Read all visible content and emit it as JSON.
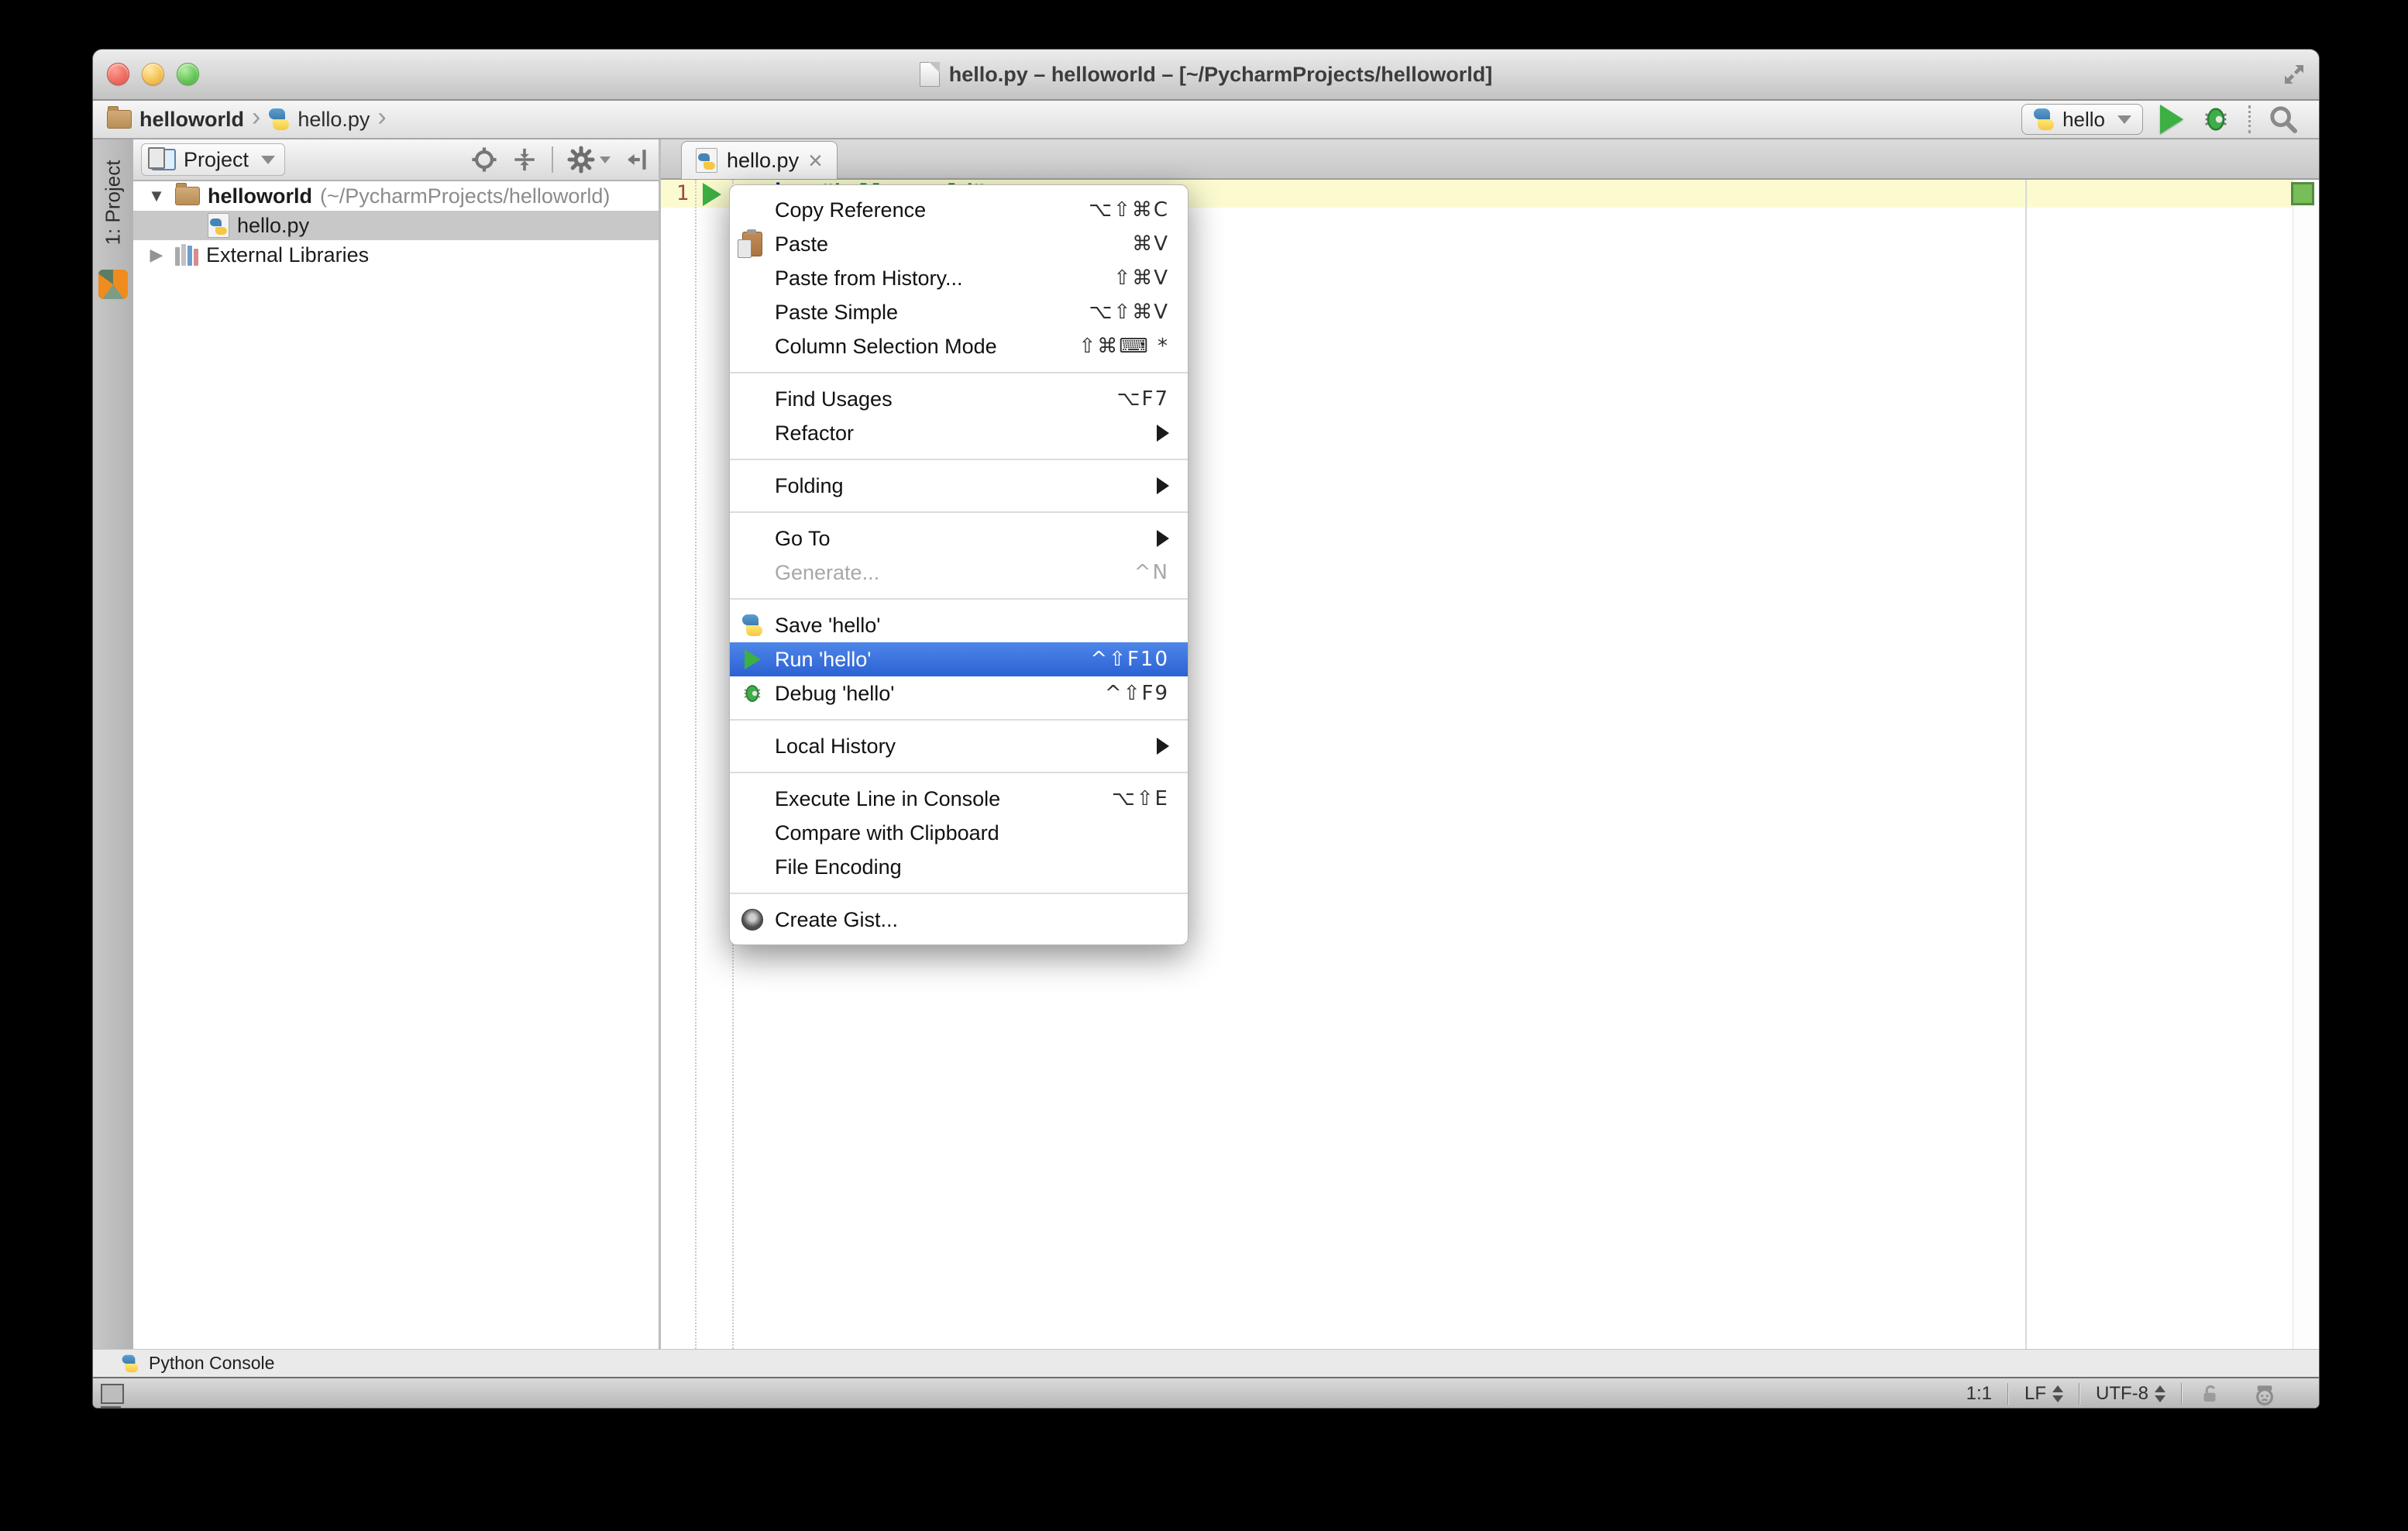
{
  "titlebar": {
    "title": "hello.py – helloworld – [~/PycharmProjects/helloworld]"
  },
  "navbar": {
    "crumb_project": "helloworld",
    "crumb_file": "hello.py",
    "run_config": "hello"
  },
  "left_stripe": {
    "project_button": "1: Project"
  },
  "project_panel": {
    "header_title": "Project",
    "root_label": "helloworld",
    "root_path": "(~/PycharmProjects/helloworld)",
    "file_label": "hello.py",
    "libs_label": "External Libraries"
  },
  "editor": {
    "tab_label": "hello.py",
    "line_number": "1",
    "code_keyword": "print",
    "code_string": "\"hello world\""
  },
  "context_menu": {
    "items": [
      {
        "label": "Copy Reference",
        "shortcut": "⌥⇧⌘C"
      },
      {
        "label": "Paste",
        "shortcut": "⌘V"
      },
      {
        "label": "Paste from History...",
        "shortcut": "⇧⌘V"
      },
      {
        "label": "Paste Simple",
        "shortcut": "⌥⇧⌘V"
      },
      {
        "label": "Column Selection Mode",
        "shortcut": "⇧⌘⌨ *"
      },
      {
        "label": "Find Usages",
        "shortcut": "⌥F7"
      },
      {
        "label": "Refactor",
        "shortcut": ""
      },
      {
        "label": "Folding",
        "shortcut": ""
      },
      {
        "label": "Go To",
        "shortcut": ""
      },
      {
        "label": "Generate...",
        "shortcut": "^N"
      },
      {
        "label": "Save 'hello'",
        "shortcut": ""
      },
      {
        "label": "Run 'hello'",
        "shortcut": "^⇧F10"
      },
      {
        "label": "Debug 'hello'",
        "shortcut": "^⇧F9"
      },
      {
        "label": "Local History",
        "shortcut": ""
      },
      {
        "label": "Execute Line in Console",
        "shortcut": "⌥⇧E"
      },
      {
        "label": "Compare with Clipboard",
        "shortcut": ""
      },
      {
        "label": "File Encoding",
        "shortcut": ""
      },
      {
        "label": "Create Gist...",
        "shortcut": ""
      }
    ]
  },
  "console_bar": {
    "label": "Python Console"
  },
  "status_bar": {
    "caret": "1:1",
    "line_separator": "LF",
    "encoding": "UTF-8"
  },
  "icons": {
    "chevron": "›",
    "expanded": "▼",
    "collapsed": "▶",
    "close": "×"
  },
  "colors": {
    "selection_blue": "#3875d7",
    "run_green": "#3cb043",
    "line_highlight": "#fbfbcf",
    "keyword_blue": "#000097",
    "string_green": "#007d00",
    "inspection_ok_green": "#77bd58",
    "traffic_red": "#ec6a5e",
    "traffic_yellow": "#f5bf4f",
    "traffic_green": "#61c554"
  }
}
